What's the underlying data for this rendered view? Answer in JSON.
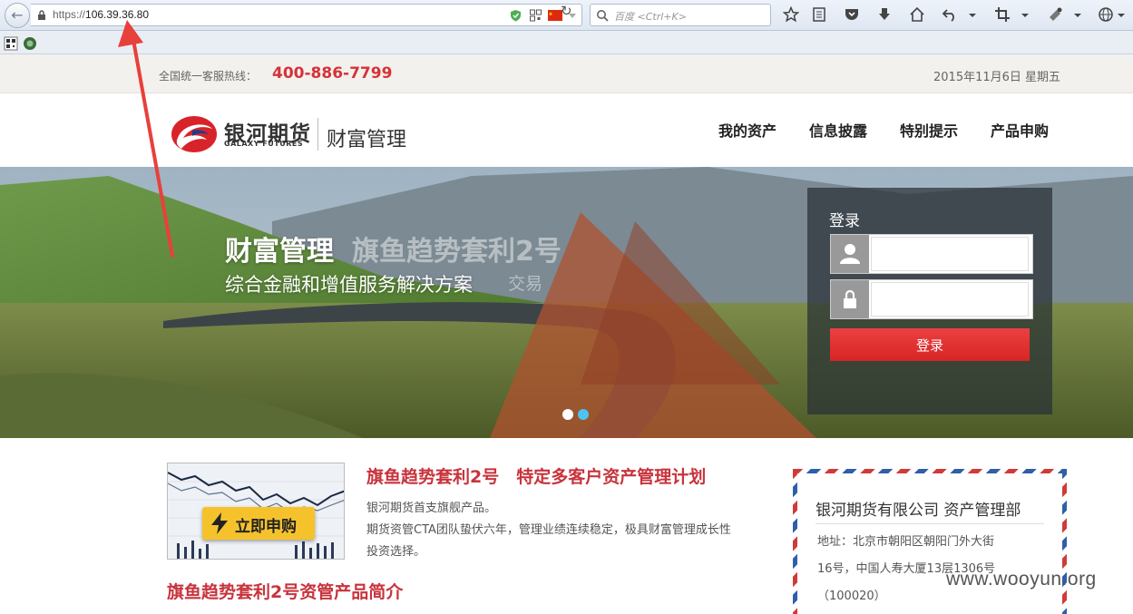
{
  "browser": {
    "url_prefix": "https://",
    "url_host": "106.39.36.80",
    "search_placeholder": "百度 <Ctrl+K>"
  },
  "topbar": {
    "hotline_label": "全国统一客服热线：",
    "hotline_number": "400-886-7799",
    "date": "2015年11月6日 星期五"
  },
  "header": {
    "logo_cn": "银河期货",
    "logo_en": "GALAXY FUTURES",
    "logo_sub": "财富管理",
    "nav": [
      "我的资产",
      "信息披露",
      "特别提示",
      "产品申购"
    ]
  },
  "banner": {
    "title_a": "财富管理",
    "title_b": "旗鱼趋势套利2号",
    "subtitle_a": "综合金融和增值服务解决方案",
    "subtitle_b": "交易",
    "active_slide": 2,
    "slide_count": 2
  },
  "login": {
    "title": "登录",
    "button_label": "登录"
  },
  "product": {
    "badge_label": "立即申购",
    "title": "旗鱼趋势套利2号　特定多客户资产管理计划",
    "desc_lines": [
      "银河期货首支旗舰产品。",
      "期货资管CTA团队蛰伏六年，管理业绩连续稳定，极具财富管理成长性",
      "投资选择。"
    ],
    "section_title": "旗鱼趋势套利2号资管产品简介"
  },
  "contact": {
    "title": "银河期货有限公司 资产管理部",
    "lines": [
      "地址：北京市朝阳区朝阳门外大街",
      "16号，中国人寿大厦13层1306号",
      "（100020）"
    ]
  },
  "watermark": "www.wooyun.org",
  "colors": {
    "brand_red": "#d6323a",
    "login_button": "#e03333",
    "badge_yellow": "#f6c22c",
    "annotation_arrow": "#e8403c"
  }
}
